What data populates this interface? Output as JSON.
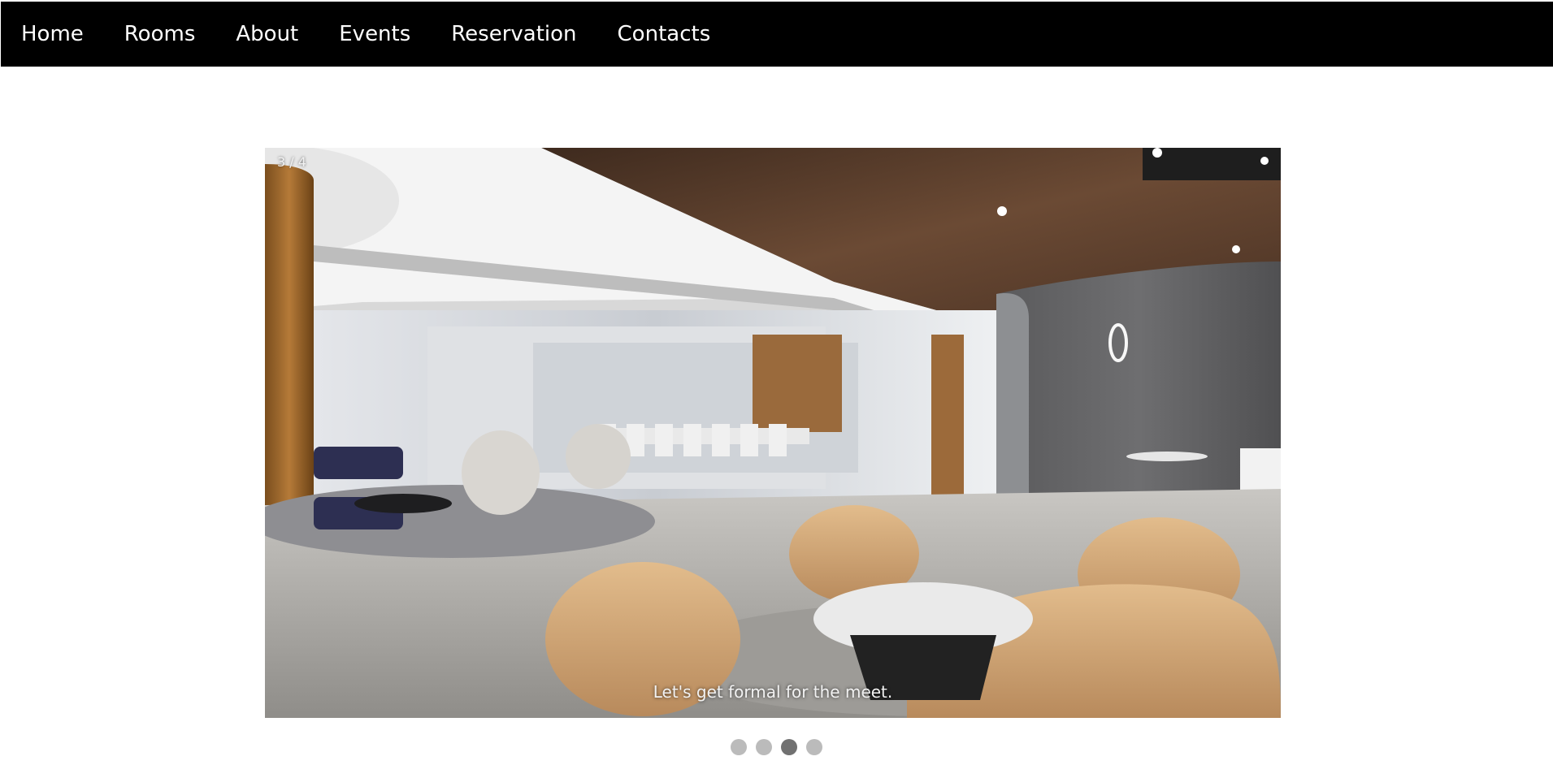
{
  "nav": {
    "items": [
      {
        "label": "Home"
      },
      {
        "label": "Rooms"
      },
      {
        "label": "About"
      },
      {
        "label": "Events"
      },
      {
        "label": "Reservation"
      },
      {
        "label": "Contacts"
      }
    ]
  },
  "slideshow": {
    "counter": "3 / 4",
    "caption": "Let's get formal for the meet.",
    "total_slides": 4,
    "active_slide": 3,
    "image": "modern office lounge with armchairs and glass meeting rooms"
  },
  "colors": {
    "nav_background": "#000000",
    "nav_text": "#ffffff",
    "dot_inactive": "#bbbbbb",
    "dot_active": "#717171"
  }
}
